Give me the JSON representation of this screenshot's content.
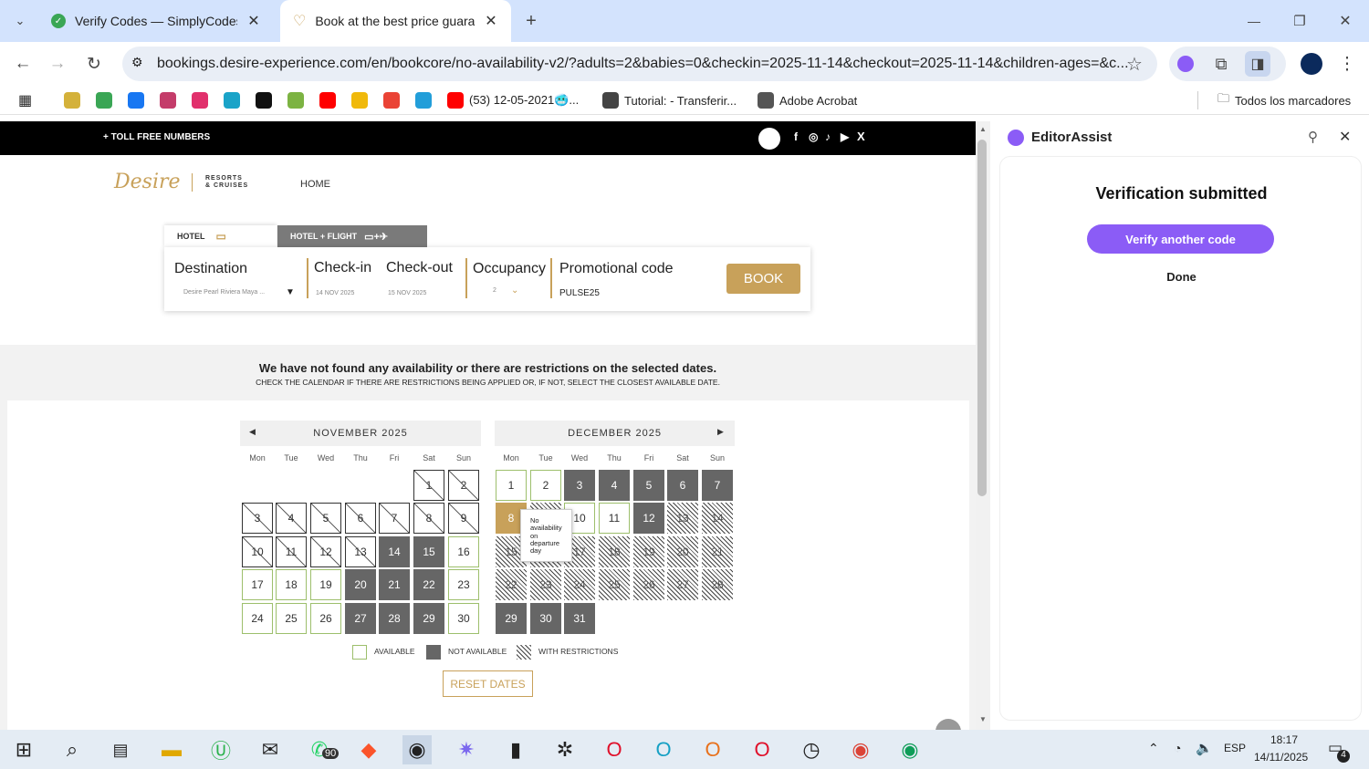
{
  "browser": {
    "tabs": [
      {
        "title": "Verify Codes — SimplyCodes",
        "close": "✕"
      },
      {
        "title": "Book at the best price guarante",
        "close": "✕"
      }
    ],
    "new_tab": "+",
    "window_controls": {
      "min": "—",
      "max": "❐",
      "close": "✕"
    },
    "url": "bookings.desire-experience.com/en/bookcore/no-availability-v2/?adults=2&babies=0&checkin=2025-11-14&checkout=2025-11-14&children-ages=&c...",
    "bookmarks": [
      {
        "label": "",
        "color": "#d4b13a"
      },
      {
        "label": "",
        "color": "#3aa655"
      },
      {
        "label": "",
        "color": "#1877f2"
      },
      {
        "label": "",
        "color": "#c43c6a"
      },
      {
        "label": "",
        "color": "#e1306c"
      },
      {
        "label": "",
        "color": "#1aa3c8"
      },
      {
        "label": "",
        "color": "#111111"
      },
      {
        "label": "",
        "color": "#7cb342"
      },
      {
        "label": "",
        "color": "#ff0000"
      },
      {
        "label": "",
        "color": "#f0b90b"
      },
      {
        "label": "",
        "color": "#ea4335"
      },
      {
        "label": "",
        "color": "#229ed9"
      },
      {
        "label": "(53) 12-05-2021🥶...",
        "color": "#ff0000"
      },
      {
        "label": "Tutorial: - Transferir...",
        "color": "#444444"
      },
      {
        "label": "Adobe Acrobat",
        "color": "#555555"
      }
    ],
    "all_bookmarks": "Todos los marcadores"
  },
  "site": {
    "toll_free": "+ TOLL FREE NUMBERS",
    "logo_script": "Desire",
    "logo_small": [
      "RESORTS",
      "& CRUISES"
    ],
    "nav_home": "HOME",
    "tab_hotel": "HOTEL",
    "tab_hotel_flight": "HOTEL + FLIGHT",
    "destination_label": "Destination",
    "destination_value": "Desire Pearl Riviera Maya ...",
    "checkin_label": "Check-in",
    "checkin_value": "14  NOV 2025",
    "checkout_label": "Check-out",
    "checkout_value": "15  NOV 2025",
    "occupancy_label": "Occupancy",
    "occupancy_value": "2",
    "promo_label": "Promotional code",
    "promo_value": "PULSE25",
    "book_button": "BOOK",
    "notice_title": "We have not found any availability or there are restrictions on the selected dates.",
    "notice_sub": "CHECK THE CALENDAR IF THERE ARE RESTRICTIONS BEING APPLIED OR, IF NOT, SELECT THE CLOSEST AVAILABLE DATE.",
    "weekdays": [
      "Mon",
      "Tue",
      "Wed",
      "Thu",
      "Fri",
      "Sat",
      "Sun"
    ],
    "november": {
      "title": "NOVEMBER 2025",
      "offset": 5,
      "days": [
        {
          "d": "1",
          "s": "past"
        },
        {
          "d": "2",
          "s": "past"
        },
        {
          "d": "3",
          "s": "past"
        },
        {
          "d": "4",
          "s": "past"
        },
        {
          "d": "5",
          "s": "past"
        },
        {
          "d": "6",
          "s": "past"
        },
        {
          "d": "7",
          "s": "past"
        },
        {
          "d": "8",
          "s": "past"
        },
        {
          "d": "9",
          "s": "past"
        },
        {
          "d": "10",
          "s": "past"
        },
        {
          "d": "11",
          "s": "past"
        },
        {
          "d": "12",
          "s": "past"
        },
        {
          "d": "13",
          "s": "past"
        },
        {
          "d": "14",
          "s": "navail"
        },
        {
          "d": "15",
          "s": "navail"
        },
        {
          "d": "16",
          "s": "avail"
        },
        {
          "d": "17",
          "s": "avail"
        },
        {
          "d": "18",
          "s": "avail"
        },
        {
          "d": "19",
          "s": "avail"
        },
        {
          "d": "20",
          "s": "navail"
        },
        {
          "d": "21",
          "s": "navail"
        },
        {
          "d": "22",
          "s": "navail"
        },
        {
          "d": "23",
          "s": "avail"
        },
        {
          "d": "24",
          "s": "avail"
        },
        {
          "d": "25",
          "s": "avail"
        },
        {
          "d": "26",
          "s": "avail"
        },
        {
          "d": "27",
          "s": "navail"
        },
        {
          "d": "28",
          "s": "navail"
        },
        {
          "d": "29",
          "s": "navail"
        },
        {
          "d": "30",
          "s": "avail"
        }
      ]
    },
    "december": {
      "title": "DECEMBER 2025",
      "offset": 0,
      "days": [
        {
          "d": "1",
          "s": "avail"
        },
        {
          "d": "2",
          "s": "avail"
        },
        {
          "d": "3",
          "s": "navail"
        },
        {
          "d": "4",
          "s": "navail"
        },
        {
          "d": "5",
          "s": "navail"
        },
        {
          "d": "6",
          "s": "navail"
        },
        {
          "d": "7",
          "s": "navail"
        },
        {
          "d": "8",
          "s": "sel"
        },
        {
          "d": "9",
          "s": "restr"
        },
        {
          "d": "10",
          "s": "avail"
        },
        {
          "d": "11",
          "s": "avail"
        },
        {
          "d": "12",
          "s": "navail"
        },
        {
          "d": "13",
          "s": "restr"
        },
        {
          "d": "14",
          "s": "restr"
        },
        {
          "d": "15",
          "s": "restr"
        },
        {
          "d": "16",
          "s": "restr"
        },
        {
          "d": "17",
          "s": "restr"
        },
        {
          "d": "18",
          "s": "restr"
        },
        {
          "d": "19",
          "s": "restr"
        },
        {
          "d": "20",
          "s": "restr"
        },
        {
          "d": "21",
          "s": "restr"
        },
        {
          "d": "22",
          "s": "restr"
        },
        {
          "d": "23",
          "s": "restr"
        },
        {
          "d": "24",
          "s": "restr"
        },
        {
          "d": "25",
          "s": "restr"
        },
        {
          "d": "26",
          "s": "restr"
        },
        {
          "d": "27",
          "s": "restr"
        },
        {
          "d": "28",
          "s": "restr"
        },
        {
          "d": "29",
          "s": "navail"
        },
        {
          "d": "30",
          "s": "navail"
        },
        {
          "d": "31",
          "s": "navail"
        }
      ]
    },
    "tooltip": "No availability on departure day",
    "legend": {
      "available": "AVAILABLE",
      "not_available": "NOT AVAILABLE",
      "restrictions": "WITH RESTRICTIONS"
    },
    "reset": "RESET DATES"
  },
  "panel": {
    "title": "EditorAssist",
    "heading": "Verification submitted",
    "primary": "Verify another code",
    "secondary": "Done",
    "accent": "#8b5cf6"
  },
  "taskbar": {
    "badge_whatsapp": "90",
    "lang": "ESP",
    "time": "18:17",
    "date": "14/11/2025",
    "notif": "4"
  }
}
